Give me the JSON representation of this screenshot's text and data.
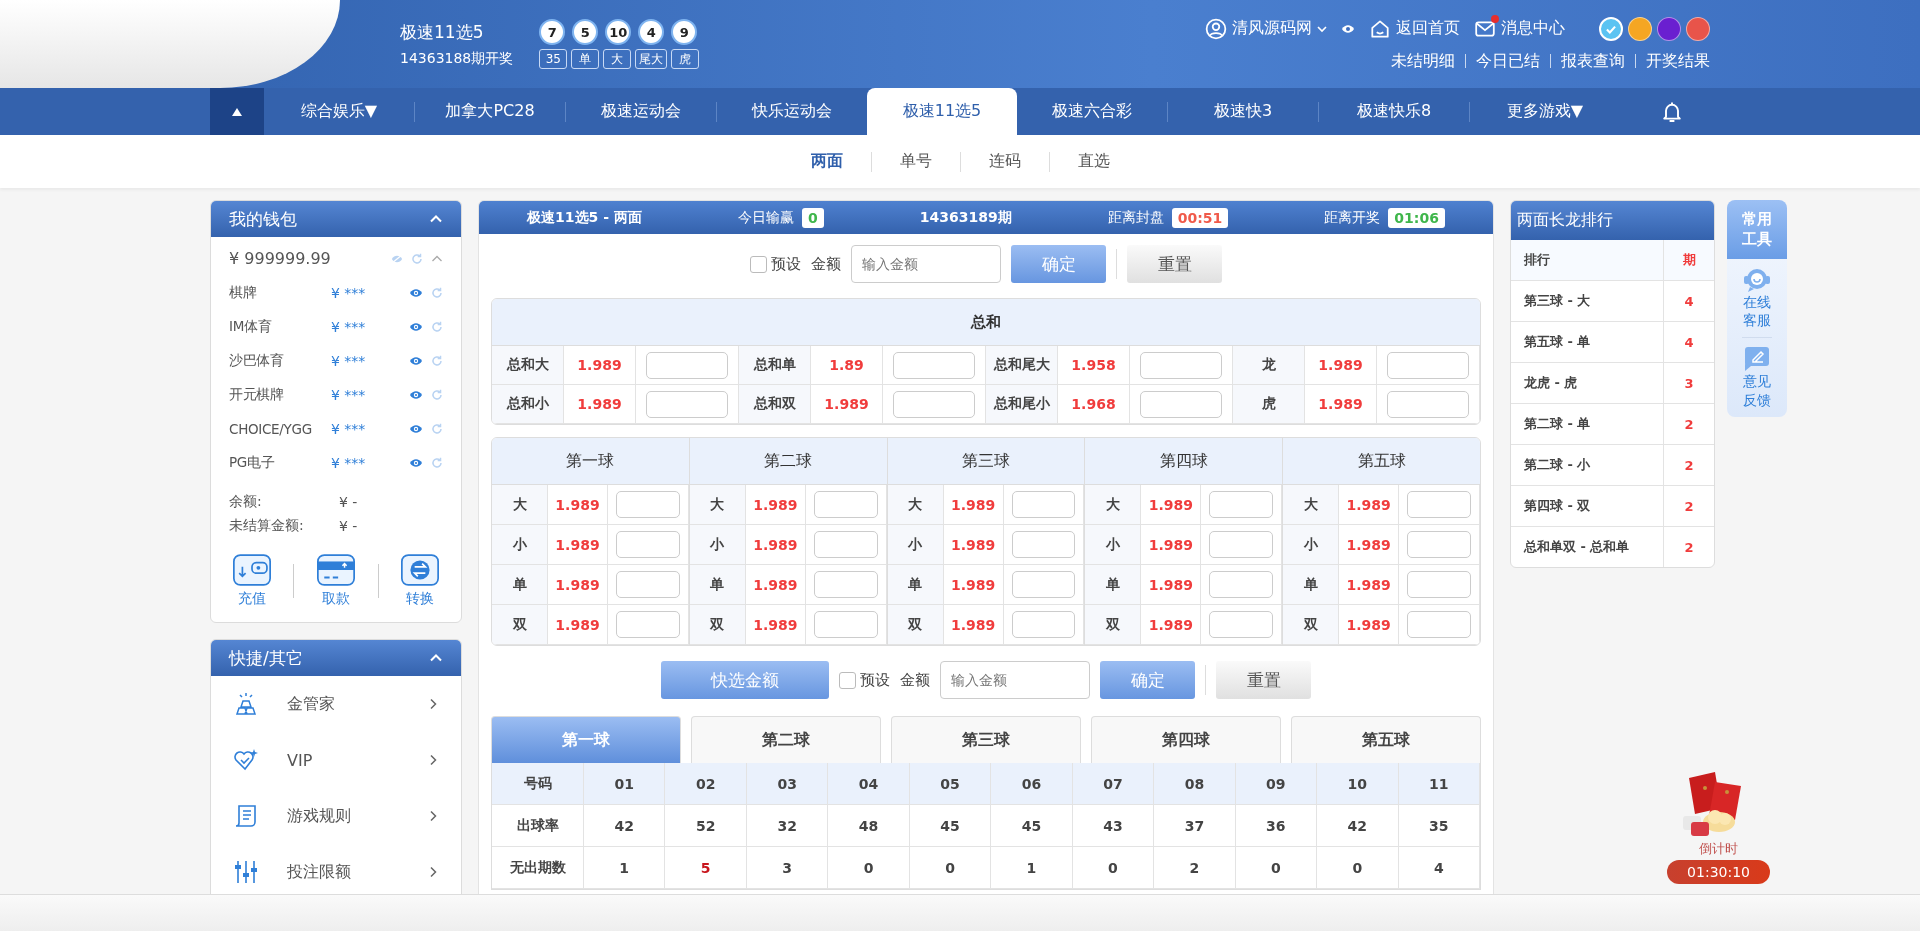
{
  "header": {
    "game_title": "极速11选5",
    "draw_label": "14363188期开奖",
    "balls": [
      "7",
      "5",
      "10",
      "4",
      "9"
    ],
    "tags": [
      "35",
      "单",
      "大",
      "尾大",
      "虎"
    ],
    "user": "清风源码网",
    "links": [
      {
        "label": "返回首页",
        "kind": "home",
        "unread": false
      },
      {
        "label": "消息中心",
        "kind": "mail",
        "unread": true
      }
    ],
    "themes": [
      {
        "color": "#5bc3f2",
        "selected": true
      },
      {
        "color": "#f5a623",
        "selected": false
      },
      {
        "color": "#6a1fd0",
        "selected": false
      },
      {
        "color": "#e8544a",
        "selected": false
      }
    ],
    "sub_links": [
      "未结明细",
      "今日已结",
      "报表查询",
      "开奖结果"
    ]
  },
  "nav": {
    "items": [
      {
        "label": "综合娱乐▼",
        "selected": false
      },
      {
        "label": "加拿大PC28",
        "selected": false
      },
      {
        "label": "极速运动会",
        "selected": false
      },
      {
        "label": "快乐运动会",
        "selected": false
      },
      {
        "label": "极速11选5",
        "selected": true
      },
      {
        "label": "极速六合彩",
        "selected": false
      },
      {
        "label": "极速快3",
        "selected": false
      },
      {
        "label": "极速快乐8",
        "selected": false
      },
      {
        "label": "更多游戏▼",
        "selected": false
      }
    ]
  },
  "subnav": [
    {
      "label": "两面",
      "selected": true
    },
    {
      "label": "单号",
      "selected": false
    },
    {
      "label": "连码",
      "selected": false
    },
    {
      "label": "直选",
      "selected": false
    }
  ],
  "wallet": {
    "title": "我的钱包",
    "balance": "¥ 999999.99",
    "accounts": [
      {
        "name": "棋牌",
        "amount": "¥ ***"
      },
      {
        "name": "IM体育",
        "amount": "¥ ***"
      },
      {
        "name": "沙巴体育",
        "amount": "¥ ***"
      },
      {
        "name": "开元棋牌",
        "amount": "¥ ***"
      },
      {
        "name": "CHOICE/YGG",
        "amount": "¥ ***"
      },
      {
        "name": "PG电子",
        "amount": "¥ ***"
      }
    ],
    "summary": [
      {
        "label": "余额:",
        "value": "¥ -"
      },
      {
        "label": "未结算金额:",
        "value": "¥ -"
      }
    ],
    "actions": [
      {
        "label": "充值",
        "kind": "deposit"
      },
      {
        "label": "取款",
        "kind": "withdraw"
      },
      {
        "label": "转换",
        "kind": "transfer"
      }
    ]
  },
  "quick": {
    "title": "快捷/其它",
    "items": [
      {
        "label": "金管家",
        "kind": "gold"
      },
      {
        "label": "VIP",
        "kind": "vip"
      },
      {
        "label": "游戏规则",
        "kind": "rules"
      },
      {
        "label": "投注限额",
        "kind": "limit"
      }
    ]
  },
  "board": {
    "title": "极速11选5 - 两面",
    "today_label": "今日输赢",
    "today_value": "0",
    "issue": "14363189期",
    "close_label": "距离封盘",
    "close_time": "00:51",
    "draw_label": "距离开奖",
    "draw_time": "01:06"
  },
  "bet_bar": {
    "preset": {
      "label": "预设",
      "checked": false
    },
    "amount_label": "金额",
    "placeholder": "输入金额",
    "confirm": "确定",
    "reset": "重置"
  },
  "sum_table": {
    "title": "总和",
    "rows": [
      [
        {
          "name": "总和大",
          "odds": "1.989"
        },
        {
          "name": "总和单",
          "odds": "1.89"
        },
        {
          "name": "总和尾大",
          "odds": "1.958"
        },
        {
          "name": "龙",
          "odds": "1.989"
        }
      ],
      [
        {
          "name": "总和小",
          "odds": "1.989"
        },
        {
          "name": "总和双",
          "odds": "1.989"
        },
        {
          "name": "总和尾小",
          "odds": "1.968"
        },
        {
          "name": "虎",
          "odds": "1.989"
        }
      ]
    ]
  },
  "ball_table": {
    "columns": [
      {
        "title": "第一球",
        "bets": [
          {
            "name": "大",
            "odds": "1.989"
          },
          {
            "name": "小",
            "odds": "1.989"
          },
          {
            "name": "单",
            "odds": "1.989"
          },
          {
            "name": "双",
            "odds": "1.989"
          }
        ]
      },
      {
        "title": "第二球",
        "bets": [
          {
            "name": "大",
            "odds": "1.989"
          },
          {
            "name": "小",
            "odds": "1.989"
          },
          {
            "name": "单",
            "odds": "1.989"
          },
          {
            "name": "双",
            "odds": "1.989"
          }
        ]
      },
      {
        "title": "第三球",
        "bets": [
          {
            "name": "大",
            "odds": "1.989"
          },
          {
            "name": "小",
            "odds": "1.989"
          },
          {
            "name": "单",
            "odds": "1.989"
          },
          {
            "name": "双",
            "odds": "1.989"
          }
        ]
      },
      {
        "title": "第四球",
        "bets": [
          {
            "name": "大",
            "odds": "1.989"
          },
          {
            "name": "小",
            "odds": "1.989"
          },
          {
            "name": "单",
            "odds": "1.989"
          },
          {
            "name": "双",
            "odds": "1.989"
          }
        ]
      },
      {
        "title": "第五球",
        "bets": [
          {
            "name": "大",
            "odds": "1.989"
          },
          {
            "name": "小",
            "odds": "1.989"
          },
          {
            "name": "单",
            "odds": "1.989"
          },
          {
            "name": "双",
            "odds": "1.989"
          }
        ]
      }
    ]
  },
  "bottom_bar": {
    "quick_amount": "快选金额",
    "preset": {
      "label": "预设",
      "checked": false
    },
    "amount_label": "金额",
    "placeholder": "输入金额",
    "confirm": "确定",
    "reset": "重置"
  },
  "stat_tabs": [
    {
      "label": "第一球",
      "selected": true
    },
    {
      "label": "第二球",
      "selected": false
    },
    {
      "label": "第三球",
      "selected": false
    },
    {
      "label": "第四球",
      "selected": false
    },
    {
      "label": "第五球",
      "selected": false
    }
  ],
  "stats": {
    "row_labels": [
      "号码",
      "出球率",
      "无出期数"
    ],
    "numbers": [
      "01",
      "02",
      "03",
      "04",
      "05",
      "06",
      "07",
      "08",
      "09",
      "10",
      "11"
    ],
    "rates": [
      "42",
      "52",
      "32",
      "48",
      "45",
      "45",
      "43",
      "37",
      "36",
      "42",
      "35"
    ],
    "missing": [
      {
        "text": "1",
        "hot": false
      },
      {
        "text": "5",
        "hot": true
      },
      {
        "text": "3",
        "hot": false
      },
      {
        "text": "0",
        "hot": false
      },
      {
        "text": "0",
        "hot": false
      },
      {
        "text": "1",
        "hot": false
      },
      {
        "text": "0",
        "hot": false
      },
      {
        "text": "2",
        "hot": false
      },
      {
        "text": "0",
        "hot": false
      },
      {
        "text": "0",
        "hot": false
      },
      {
        "text": "4",
        "hot": false
      }
    ]
  },
  "ranking": {
    "title": "两面长龙排行",
    "columns": [
      "排行",
      "期"
    ],
    "rows": [
      {
        "item": "第三球 - 大",
        "count": "4"
      },
      {
        "item": "第五球 - 单",
        "count": "4"
      },
      {
        "item": "龙虎 - 虎",
        "count": "3"
      },
      {
        "item": "第二球 - 单",
        "count": "2"
      },
      {
        "item": "第二球 - 小",
        "count": "2"
      },
      {
        "item": "第四球 - 双",
        "count": "2"
      },
      {
        "item": "总和单双 - 总和单",
        "count": "2"
      }
    ]
  },
  "tools": {
    "title": "常用工具",
    "items": [
      {
        "label": "在线客服",
        "kind": "service"
      },
      {
        "label": "意见反馈",
        "kind": "feedback"
      }
    ]
  },
  "countdown": {
    "label": "倒计时",
    "time": "01:30:10"
  }
}
